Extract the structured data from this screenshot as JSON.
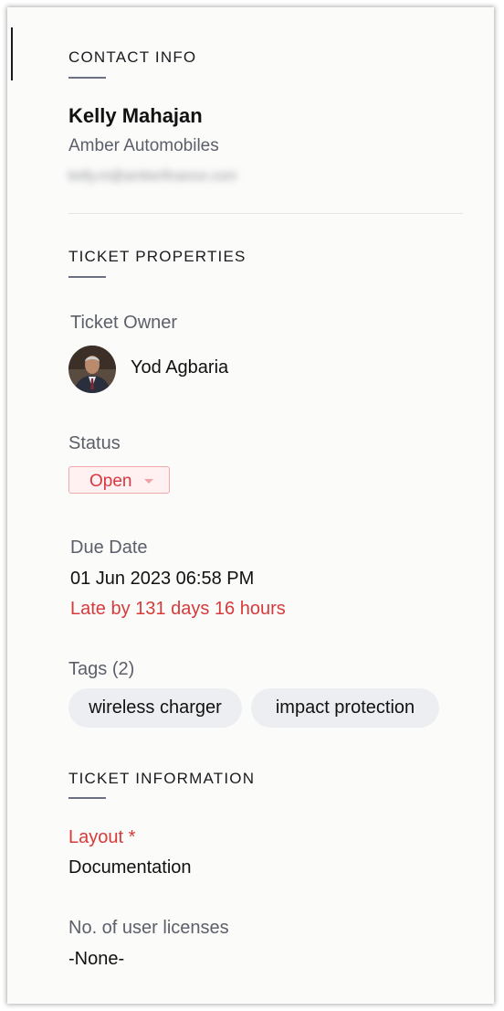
{
  "contact_info": {
    "section_title": "CONTACT INFO",
    "name": "Kelly Mahajan",
    "company": "Amber Automobiles",
    "email": "kelly.m@amberfinance.com"
  },
  "ticket_properties": {
    "section_title": "TICKET PROPERTIES",
    "owner": {
      "label": "Ticket Owner",
      "name": "Yod Agbaria",
      "avatar_icon": "person-avatar-icon"
    },
    "status": {
      "label": "Status",
      "value": "Open",
      "color": "#d9373f"
    },
    "due_date": {
      "label": "Due Date",
      "value": "01 Jun 2023 06:58 PM",
      "late_text": "Late by 131 days 16 hours",
      "late_color": "#d63b3b"
    },
    "tags": {
      "label": "Tags",
      "count": "(2)",
      "items": [
        "wireless charger",
        "impact protection"
      ]
    }
  },
  "ticket_information": {
    "section_title": "TICKET INFORMATION",
    "layout": {
      "label": "Layout *",
      "value": "Documentation"
    },
    "user_licenses": {
      "label": "No. of user licenses",
      "value": "-None-"
    }
  }
}
